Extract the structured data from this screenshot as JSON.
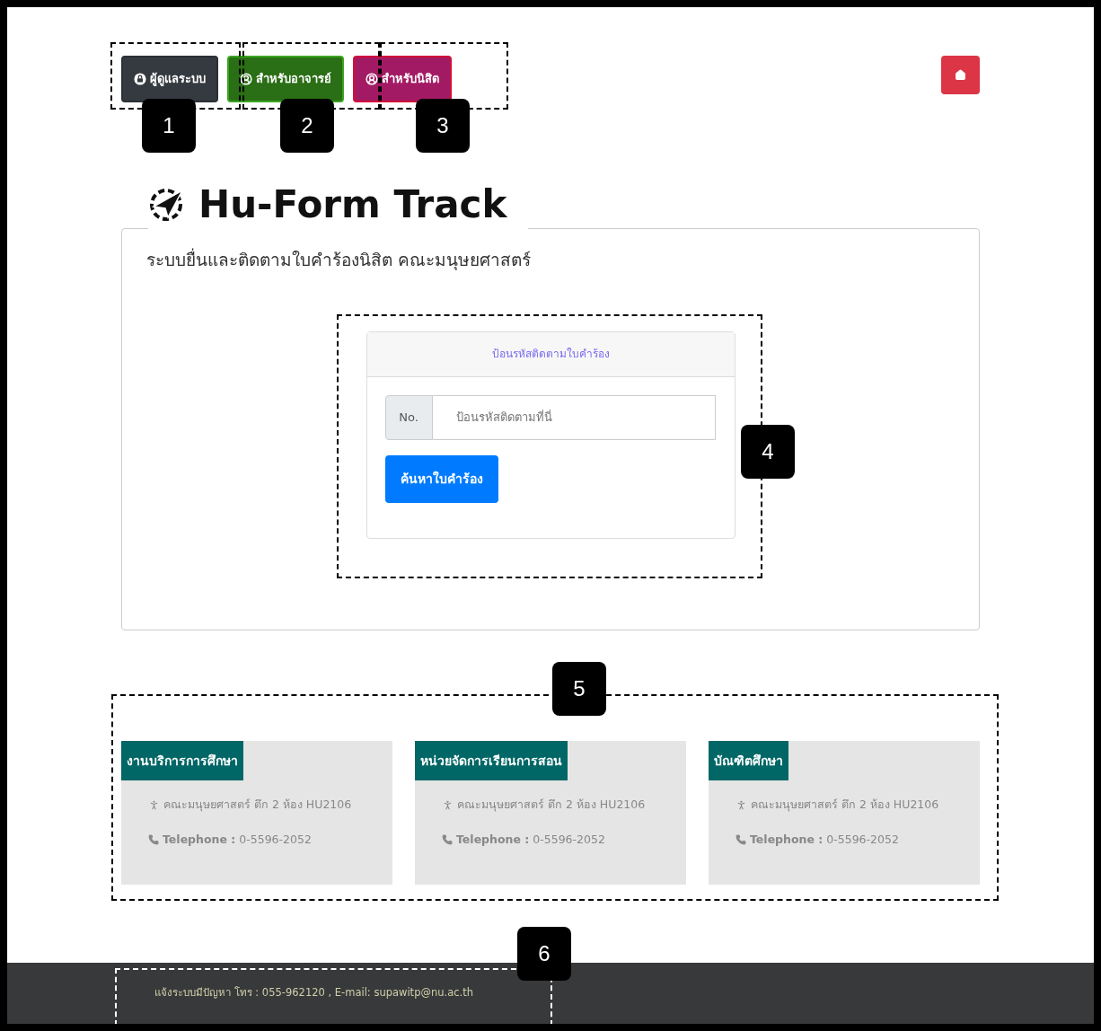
{
  "nav_buttons": [
    {
      "label": "ผู้ดูแลระบบ",
      "kind": "admin"
    },
    {
      "label": "สำหรับอาจารย์",
      "kind": "teacher"
    },
    {
      "label": "สำหรับนิสิต",
      "kind": "student"
    }
  ],
  "title": "Hu-Form Track",
  "subtitle": "ระบบยื่นและติดตามใบคำร้องนิสิต คณะมนุษยศาสตร์",
  "track_form": {
    "header": "ป้อนรหัสติดตามใบคำร้อง",
    "prefix": "No.",
    "placeholder": "ป้อนรหัสติดตามที่นี่",
    "button": "ค้นหาใบคำร้อง"
  },
  "contacts": [
    {
      "title": "งานบริการการศึกษา",
      "location": "คณะมนุษยศาสตร์ ตึก 2 ห้อง HU2106",
      "phone_label": "Telephone :",
      "phone": "0-5596-2052"
    },
    {
      "title": "หน่วยจัดการเรียนการสอน",
      "location": "คณะมนุษยศาสตร์ ตึก 2 ห้อง HU2106",
      "phone_label": "Telephone :",
      "phone": "0-5596-2052"
    },
    {
      "title": "บัณฑิตศึกษา",
      "location": "คณะมนุษยศาสตร์ ตึก 2 ห้อง HU2106",
      "phone_label": "Telephone :",
      "phone": "0-5596-2052"
    }
  ],
  "footer": "แจ้งระบบมีปัญหา โทร : 055-962120 , E-mail: supawitp@nu.ac.th",
  "annotations": [
    {
      "label": "1"
    },
    {
      "label": "2"
    },
    {
      "label": "3"
    },
    {
      "label": "4"
    },
    {
      "label": "5"
    },
    {
      "label": "6"
    }
  ]
}
